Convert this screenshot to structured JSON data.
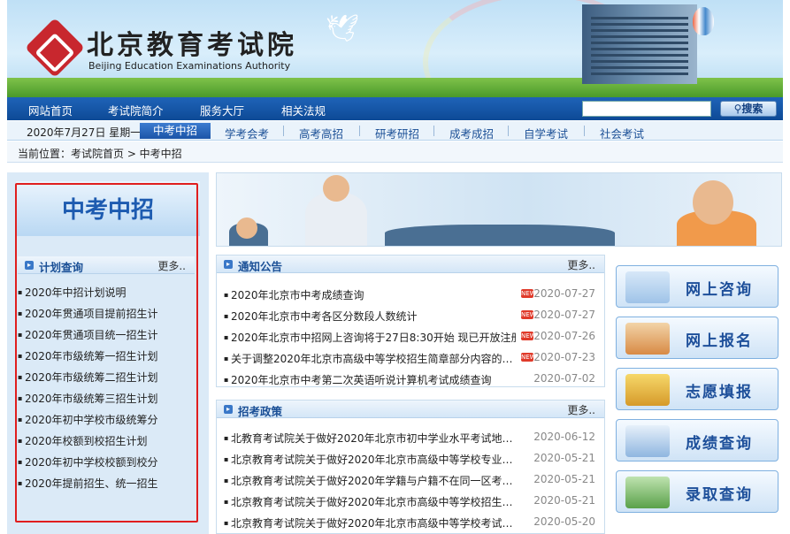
{
  "header": {
    "title_cn": "北京教育考试院",
    "title_en": "Beijing Education Examinations Authority"
  },
  "nav_main": {
    "items": [
      "网站首页",
      "考试院简介",
      "服务大厅",
      "相关法规"
    ],
    "search_placeholder": "",
    "search_button": "搜索"
  },
  "nav_sub": {
    "date": "2020年7月27日 星期一",
    "active": "中考中招",
    "items": [
      "学考会考",
      "高考高招",
      "研考研招",
      "成考成招",
      "自学考试",
      "社会考试"
    ]
  },
  "breadcrumb": "当前位置：考试院首页 > 中考中招",
  "left_panel": {
    "heading": "中考中招",
    "section_title": "计划查询",
    "more": "更多..",
    "items": [
      "2020年中招计划说明",
      "2020年贯通项目提前招生计",
      "2020年贯通项目统一招生计",
      "2020年市级统筹一招生计划",
      "2020年市级统筹二招生计划",
      "2020年市级统筹三招生计划",
      "2020年初中学校市级统筹分",
      "2020年校额到校招生计划",
      "2020年初中学校校额到校分",
      "2020年提前招生、统一招生"
    ]
  },
  "notices": {
    "title": "通知公告",
    "more": "更多..",
    "rows": [
      {
        "text": "2020年北京市中考成绩查询",
        "date": "2020-07-27",
        "new": "NEW"
      },
      {
        "text": "2020年北京市中考各区分数段人数统计",
        "date": "2020-07-27",
        "new": "NEW"
      },
      {
        "text": "2020年北京市中招网上咨询将于27日8:30开始 现已开放注册",
        "date": "2020-07-26",
        "new": "NEW"
      },
      {
        "text": "关于调整2020年北京市高级中等学校招生简章部分内容的…",
        "date": "2020-07-23",
        "new": "NEW"
      },
      {
        "text": "2020年北京市中考第二次英语听说计算机考试成绩查询",
        "date": "2020-07-02",
        "new": ""
      }
    ]
  },
  "policies": {
    "title": "招考政策",
    "more": "更多..",
    "rows": [
      {
        "text": "北教育考试院关于做好2020年北京市初中学业水平考试地…",
        "date": "2020-06-12"
      },
      {
        "text": "北京教育考试院关于做好2020年北京市高级中等学校专业…",
        "date": "2020-05-21"
      },
      {
        "text": "北京教育考试院关于做好2020年学籍与户籍不在同一区考…",
        "date": "2020-05-21"
      },
      {
        "text": "北京教育考试院关于做好2020年北京市高级中等学校招生…",
        "date": "2020-05-21"
      },
      {
        "text": "北京教育考试院关于做好2020年北京市高级中等学校考试…",
        "date": "2020-05-20"
      }
    ]
  },
  "services": [
    "网上咨询",
    "网上报名",
    "志愿填报",
    "成绩查询",
    "录取查询"
  ],
  "colors": {
    "nav": "#1f63b8",
    "accent": "#1d5bb0",
    "highlight_box": "#e01e1e",
    "new_badge": "#e03a2a"
  }
}
